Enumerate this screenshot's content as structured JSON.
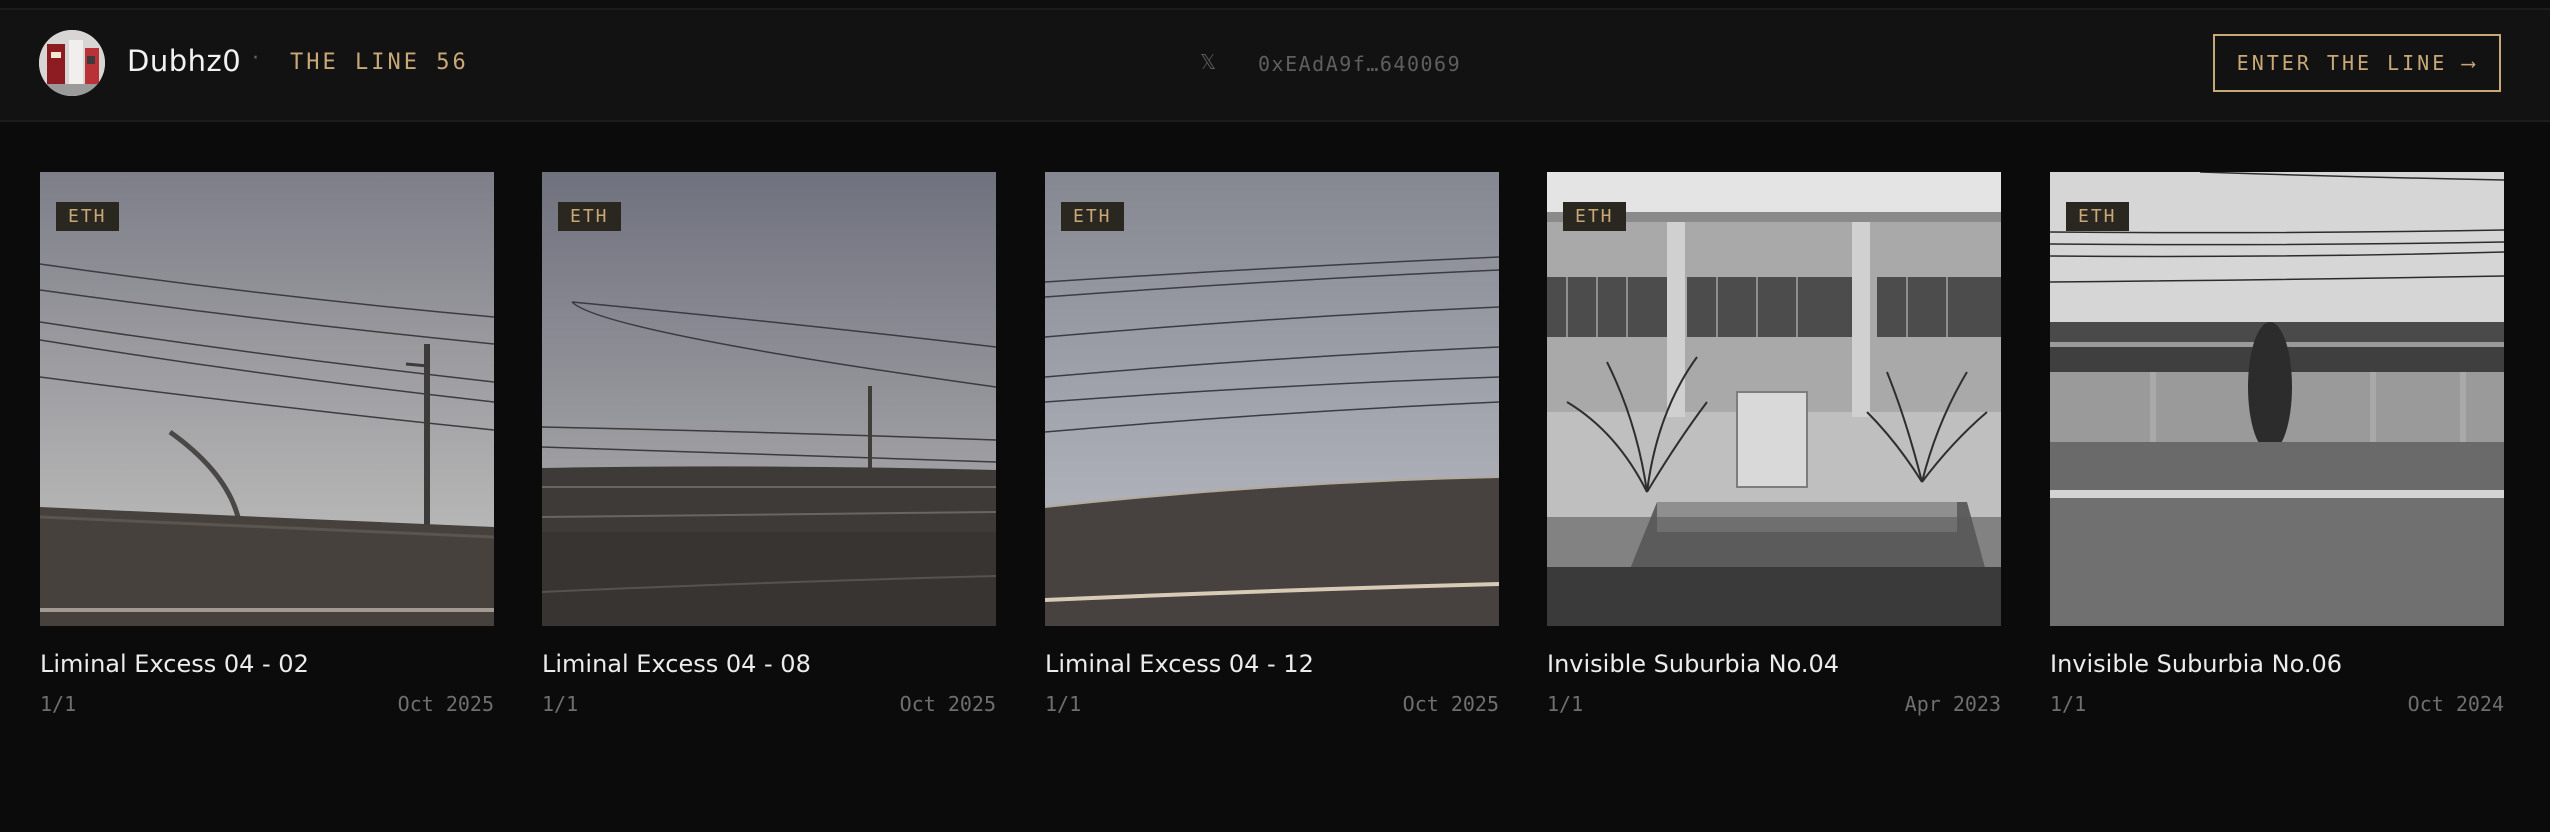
{
  "header": {
    "username": "Dubhz0",
    "separator": "·",
    "line_label": "THE LINE 56",
    "x_icon": "𝕏",
    "wallet": "0xEAdA9f…640069",
    "enter_button": "ENTER THE LINE ⟶"
  },
  "cards": [
    {
      "badge": "ETH",
      "title": "Liminal Excess 04 - 02",
      "edition": "1/1",
      "date": "Oct 2025"
    },
    {
      "badge": "ETH",
      "title": "Liminal Excess 04 - 08",
      "edition": "1/1",
      "date": "Oct 2025"
    },
    {
      "badge": "ETH",
      "title": "Liminal Excess 04 - 12",
      "edition": "1/1",
      "date": "Oct 2025"
    },
    {
      "badge": "ETH",
      "title": "Invisible Suburbia No.04",
      "edition": "1/1",
      "date": "Apr 2023"
    },
    {
      "badge": "ETH",
      "title": "Invisible Suburbia No.06",
      "edition": "1/1",
      "date": "Oct 2024"
    }
  ],
  "colors": {
    "accent": "#c9a877",
    "background": "#0b0b0b",
    "header_bg": "#121212"
  }
}
